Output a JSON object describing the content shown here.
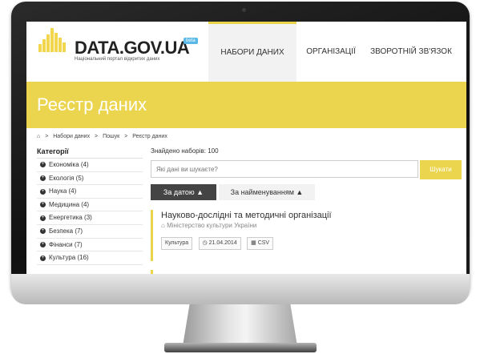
{
  "logo": {
    "title": "DATA.GOV.UA",
    "badge": "beta",
    "subtitle": "Національний портал відкритих даних"
  },
  "nav": {
    "items": [
      {
        "label": "НАБОРИ ДАНИХ",
        "active": true
      },
      {
        "label": "ОРГАНІЗАЦІЇ",
        "active": false
      },
      {
        "label": "ЗВОРОТНІЙ ЗВ'ЯЗОК",
        "active": false
      }
    ]
  },
  "banner": {
    "title": "Реєстр даних"
  },
  "breadcrumb": {
    "home_icon": "home-icon",
    "items": [
      "Набори даних",
      "Пошук",
      "Реєстр даних"
    ],
    "separator": ">"
  },
  "sidebar": {
    "heading": "Категорії",
    "items": [
      "Економіка (4)",
      "Екологія (5)",
      "Наука (4)",
      "Медицина (4)",
      "Енергетика (3)",
      "Безпека (7)",
      "Фінанси (7)",
      "Культура (16)"
    ]
  },
  "main": {
    "found_text": "Знайдено наборів: 100",
    "search": {
      "placeholder": "Які дані ви шукаєте?",
      "button": "Шукати"
    },
    "sort": {
      "by_date": "За датою ▲",
      "by_name": "За найменуванням ▲"
    },
    "dataset": {
      "title": "Науково-дослідні та методичні організації",
      "org": "Міністерство культури України",
      "tags": {
        "category": "Культура",
        "date": "21.04.2014",
        "format": "CSV"
      }
    }
  },
  "colors": {
    "accent": "#ecd54e",
    "dark_button": "#444444"
  }
}
